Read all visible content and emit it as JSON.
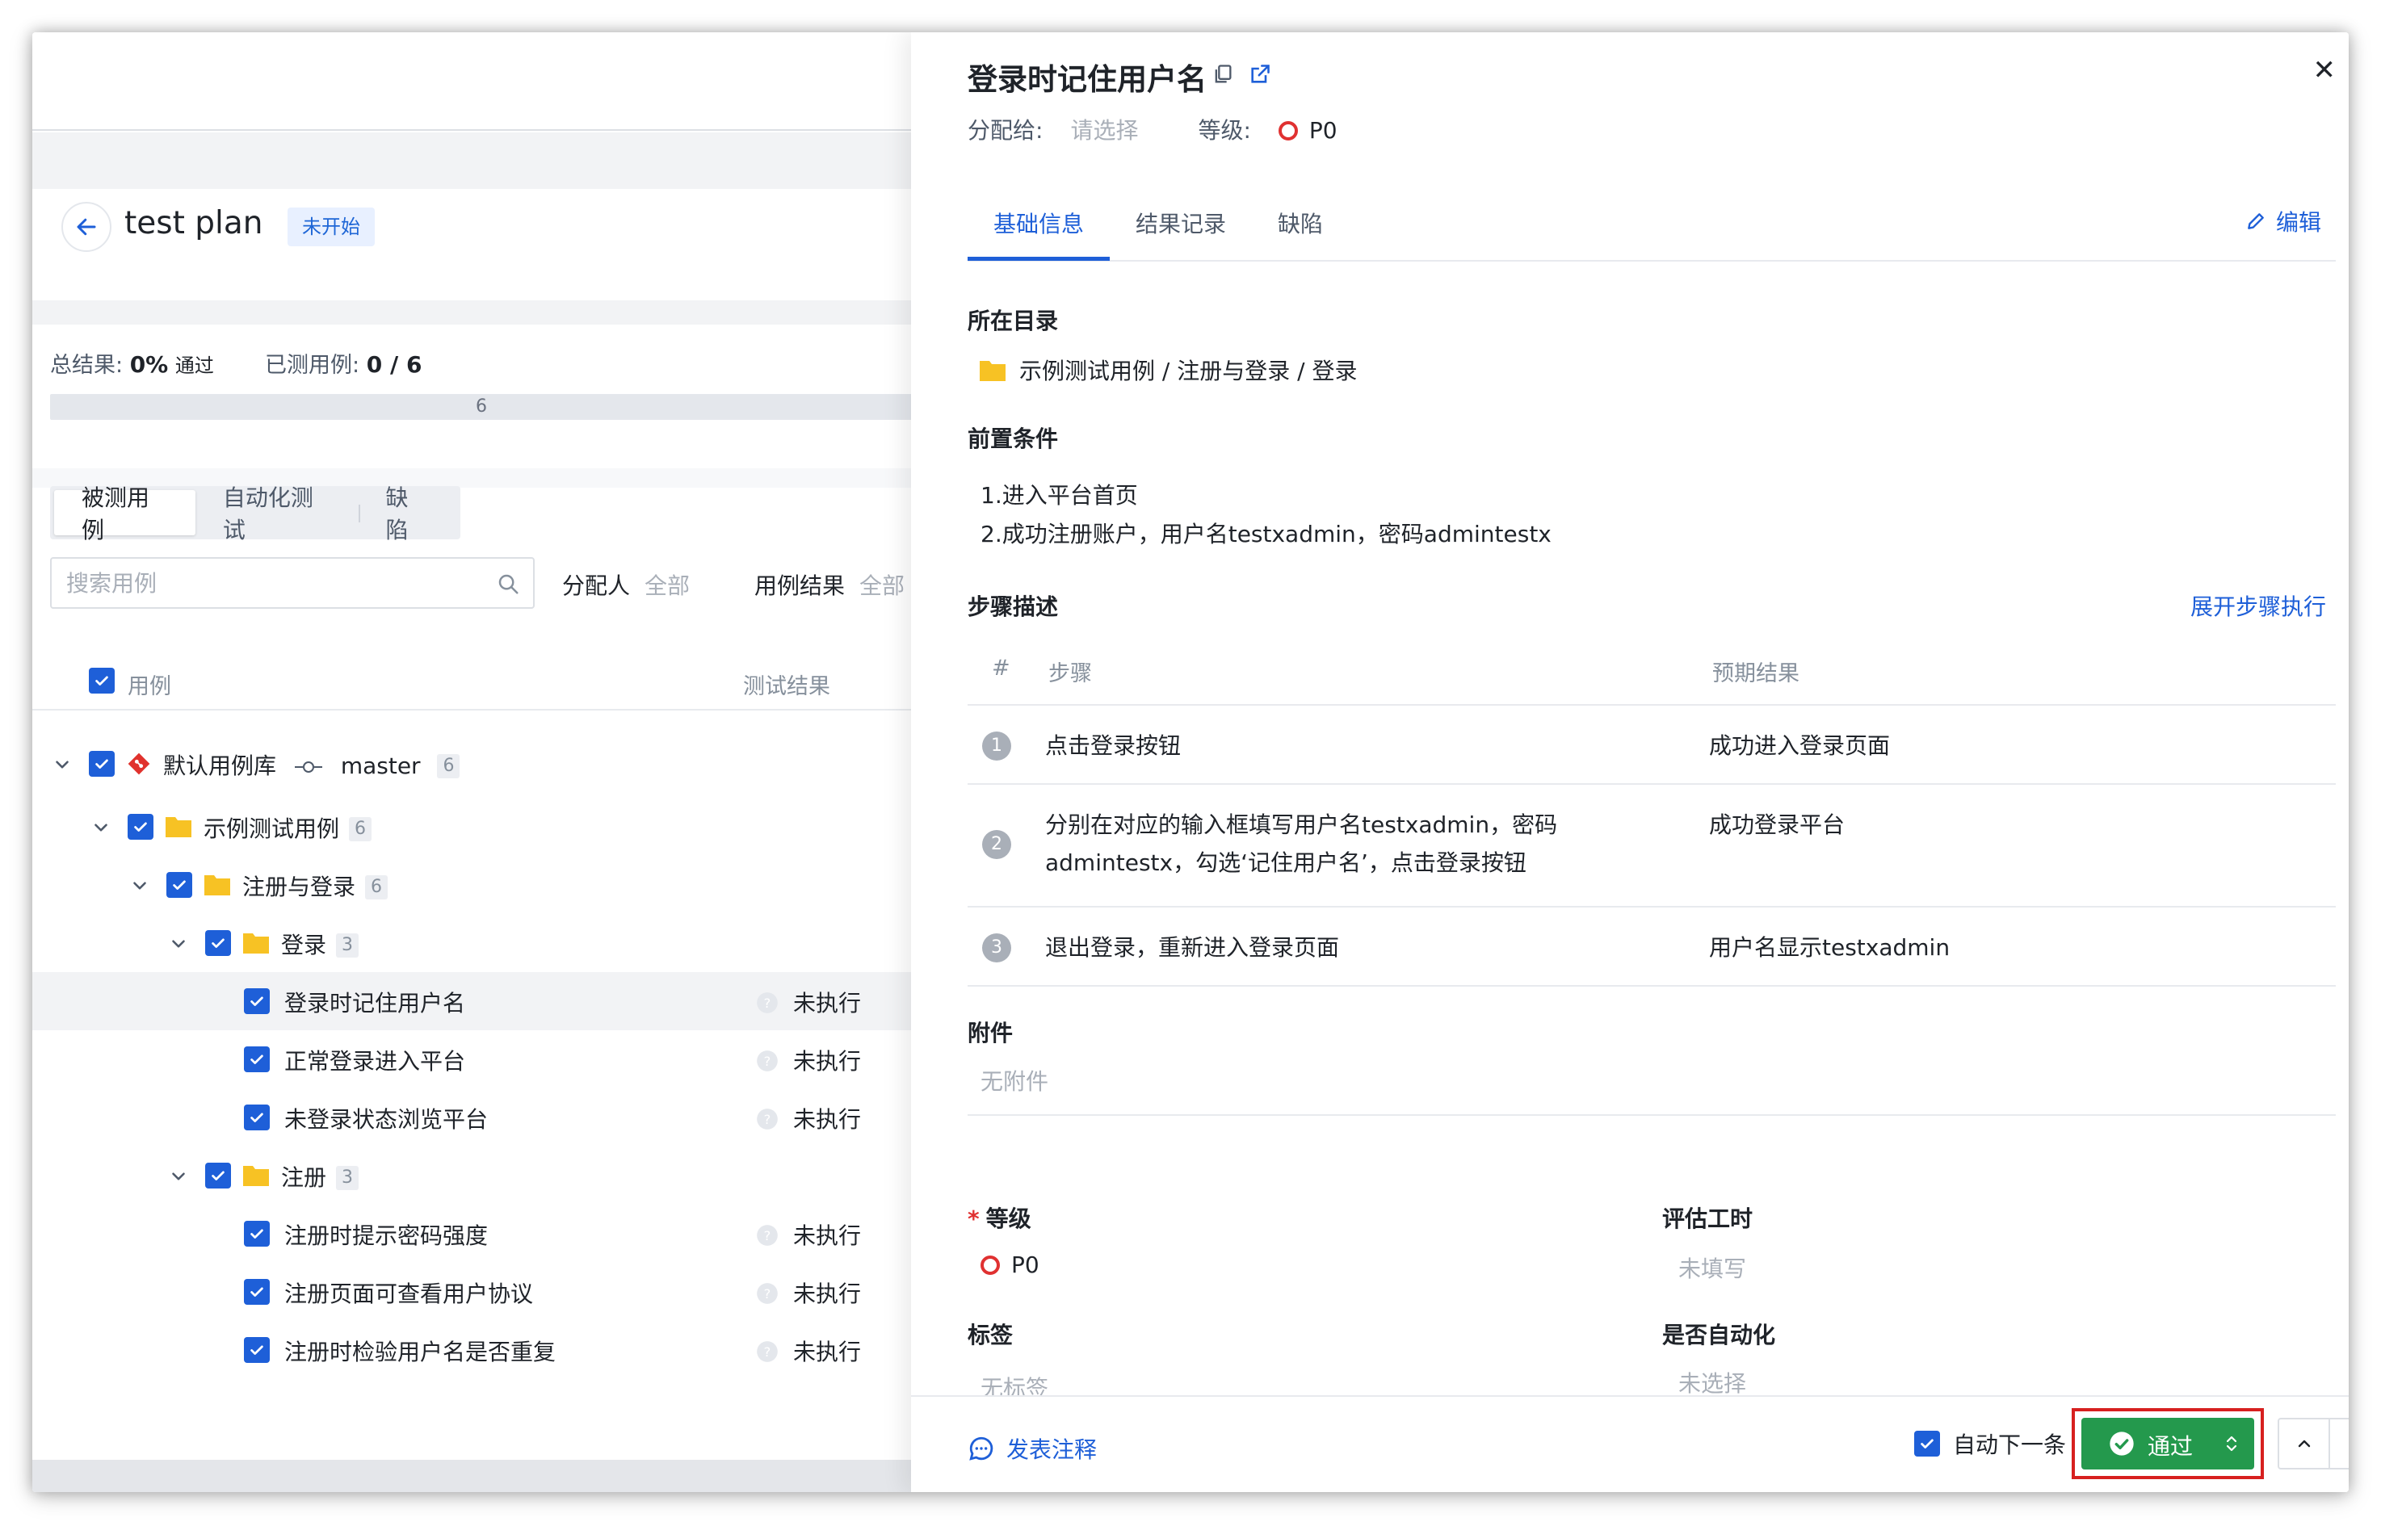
{
  "plan": {
    "title": "test plan",
    "status": "未开始"
  },
  "summary": {
    "result_label": "总结果:",
    "pass_rate": "0%",
    "pass_word": "通过",
    "tested_label": "已测用例:",
    "tested_value": "0 / 6",
    "progress_text": "6",
    "progress_fraction": 0
  },
  "left_tabs": [
    "被测用例",
    "自动化测试",
    "缺陷"
  ],
  "search": {
    "placeholder": "搜索用例"
  },
  "filters": {
    "assignee_label": "分配人",
    "assignee_value": "全部",
    "result_label": "用例结果",
    "result_value": "全部"
  },
  "list_header": {
    "case": "用例",
    "result": "测试结果"
  },
  "tree": {
    "repo": {
      "name": "默认用例库",
      "branch": "master",
      "count": "6"
    },
    "folder1": {
      "name": "示例测试用例",
      "count": "6"
    },
    "folder2": {
      "name": "注册与登录",
      "count": "6"
    },
    "folder_login": {
      "name": "登录",
      "count": "3"
    },
    "folder_register": {
      "name": "注册",
      "count": "3"
    },
    "login_cases": [
      {
        "name": "登录时记住用户名",
        "result": "未执行"
      },
      {
        "name": "正常登录进入平台",
        "result": "未执行"
      },
      {
        "name": "未登录状态浏览平台",
        "result": "未执行"
      }
    ],
    "register_cases": [
      {
        "name": "注册时提示密码强度",
        "result": "未执行"
      },
      {
        "name": "注册页面可查看用户协议",
        "result": "未执行"
      },
      {
        "name": "注册时检验用户名是否重复",
        "result": "未执行"
      }
    ]
  },
  "drawer": {
    "title": "登录时记住用户名",
    "assign_label": "分配给:",
    "assign_placeholder": "请选择",
    "level_label": "等级:",
    "level_value": "P0",
    "tabs": [
      "基础信息",
      "结果记录",
      "缺陷"
    ],
    "edit": "编辑",
    "directory_title": "所在目录",
    "directory_path": "示例测试用例 / 注册与登录 / 登录",
    "precondition_title": "前置条件",
    "preconditions": [
      "1.进入平台首页",
      "2.成功注册账户，用户名testxadmin，密码admintestx"
    ],
    "steps_title": "步骤描述",
    "expand_steps": "展开步骤执行",
    "steps_header": {
      "no": "#",
      "step": "步骤",
      "expected": "预期结果"
    },
    "steps": [
      {
        "no": "1",
        "line1": "点击登录按钮",
        "line2": "",
        "expected": "成功进入登录页面"
      },
      {
        "no": "2",
        "line1": "分别在对应的输入框填写用户名testxadmin，密码",
        "line2": "admintestx，勾选‘记住用户名’，点击登录按钮",
        "expected": "成功登录平台"
      },
      {
        "no": "3",
        "line1": "退出登录，重新进入登录页面",
        "line2": "",
        "expected": "用户名显示testxadmin"
      }
    ],
    "attachment_title": "附件",
    "attachment_empty": "无附件",
    "fields": {
      "level_label": "等级",
      "level_value": "P0",
      "estimate_label": "评估工时",
      "estimate_value": "未填写",
      "tags_label": "标签",
      "tags_value": "无标签",
      "automated_label": "是否自动化",
      "automated_value": "未选择"
    },
    "footer": {
      "comment": "发表注释",
      "auto_next": "自动下一条",
      "pass": "通过"
    }
  },
  "colors": {
    "primary": "#1e5fd8",
    "pass_green": "#24994d",
    "priority_red": "#e03131",
    "highlight_red": "#d7201f"
  }
}
